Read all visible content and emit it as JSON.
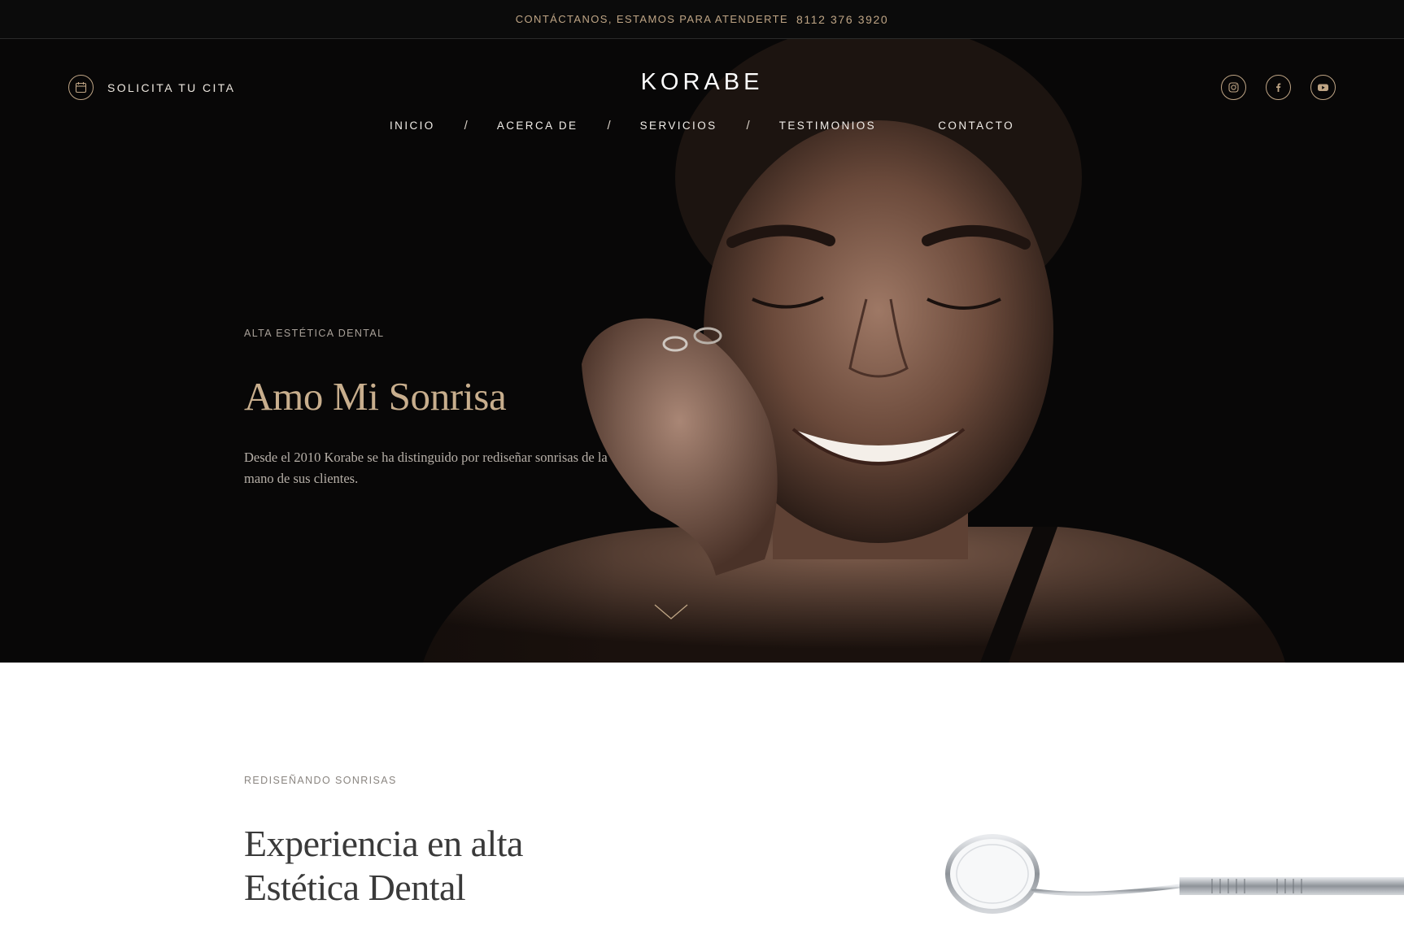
{
  "topbar": {
    "contact_text": "CONTÁCTANOS, ESTAMOS PARA ATENDERTE",
    "phone": "8112 376 3920"
  },
  "header": {
    "cta_label": "SOLICITA TU CITA",
    "cta_icon": "calendar-icon",
    "logo": "KORABE",
    "social_icons": [
      "instagram-icon",
      "facebook-icon",
      "youtube-icon"
    ]
  },
  "nav": {
    "items": [
      {
        "label": "INICIO"
      },
      {
        "label": "ACERCA DE"
      },
      {
        "label": "SERVICIOS"
      },
      {
        "label": "TESTIMONIOS"
      },
      {
        "label": "CONTACTO"
      }
    ],
    "separator": "/"
  },
  "hero": {
    "eyebrow": "ALTA ESTÉTICA DENTAL",
    "title": "Amo Mi Sonrisa",
    "description": "Desde el 2010 Korabe se ha distinguido por rediseñar sonrisas de la mano de sus clientes.",
    "scroll_icon": "chevron-down-icon"
  },
  "about": {
    "eyebrow": "REDISEÑANDO SONRISAS",
    "title_line1": "Experiencia en alta",
    "title_line2": "Estética Dental"
  },
  "colors": {
    "accent_gold": "#c8ae8d",
    "dark_bg": "#0b0b0b",
    "heading_dark": "#3a3a3a"
  }
}
